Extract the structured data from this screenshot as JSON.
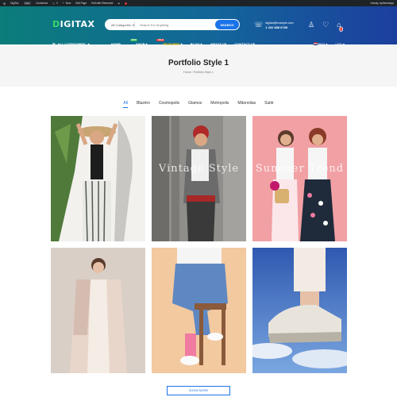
{
  "adminbar": {
    "site": "DigiTax",
    "customize": "Customize",
    "comments": "0",
    "new": "New",
    "edit_page": "Edit Page",
    "elementor": "Edit with Elementor",
    "greeting": "Howdy, wpthemeapp"
  },
  "header": {
    "logo": "DIGITAX",
    "search": {
      "category": "All Categories",
      "placeholder": "Search For Anything",
      "button": "SEARCH"
    },
    "support": {
      "email": "digitax@example.com",
      "phone": "1 202 888 6789"
    },
    "cart_count": "0"
  },
  "nav": {
    "all_categories": "ALL CATEGORIES",
    "links": [
      {
        "label": "HOME"
      },
      {
        "label": "SHOP",
        "tag": "NEW"
      },
      {
        "label": "FEATURES",
        "tag": "SALE"
      },
      {
        "label": "BLOG"
      },
      {
        "label": "ABOUT US"
      },
      {
        "label": "CONTACT US"
      }
    ],
    "language": "ENG",
    "currency": "USD"
  },
  "page": {
    "title": "Portfolio Style 1",
    "breadcrumb_home": "Home",
    "breadcrumb_sep": "/",
    "breadcrumb_current": "Portfolio Style 1"
  },
  "filters": [
    "All",
    "Blazëro",
    "Cosmopolis",
    "Glamos",
    "Metropolis",
    "Mãenolias",
    "Suitë"
  ],
  "portfolio": {
    "card2_overlay": "Vintage Style",
    "card3_overlay": "Summer Trend"
  },
  "show_more": "SHOW MORE",
  "colors": {
    "accent": "#1a73e8",
    "header_start": "#0b7d7a",
    "header_end": "#1c3f9e",
    "new_badge": "#2db84d",
    "sale_badge": "#e53935"
  }
}
